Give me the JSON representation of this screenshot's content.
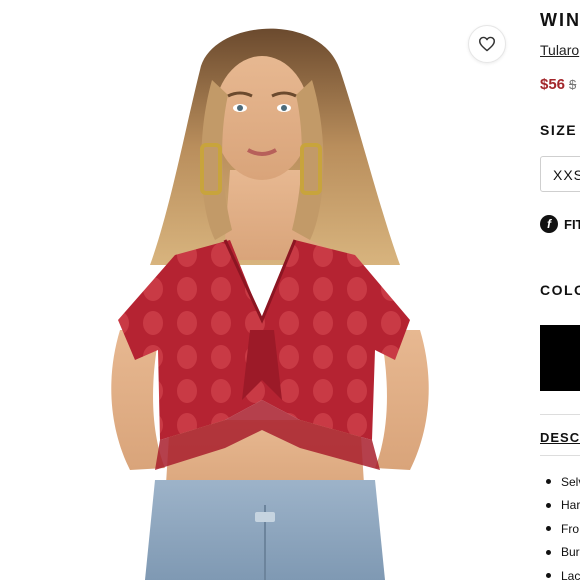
{
  "product": {
    "title": "WIN",
    "brand": "Tularo",
    "sale_price": "$56",
    "original_price": "$"
  },
  "favorite": {
    "icon": "heart-outline-icon"
  },
  "size": {
    "heading": "SIZE",
    "selected": "XXS"
  },
  "fit": {
    "icon": "fit-f-icon",
    "label": "FIT"
  },
  "color": {
    "heading": "COLO",
    "swatch": "#000000"
  },
  "description": {
    "heading": "DESC",
    "bullets": [
      "Selv",
      "Har",
      "Fro",
      "Bur",
      "Lac"
    ]
  },
  "colors": {
    "sale": "#a3262b",
    "top": "#b52332"
  }
}
